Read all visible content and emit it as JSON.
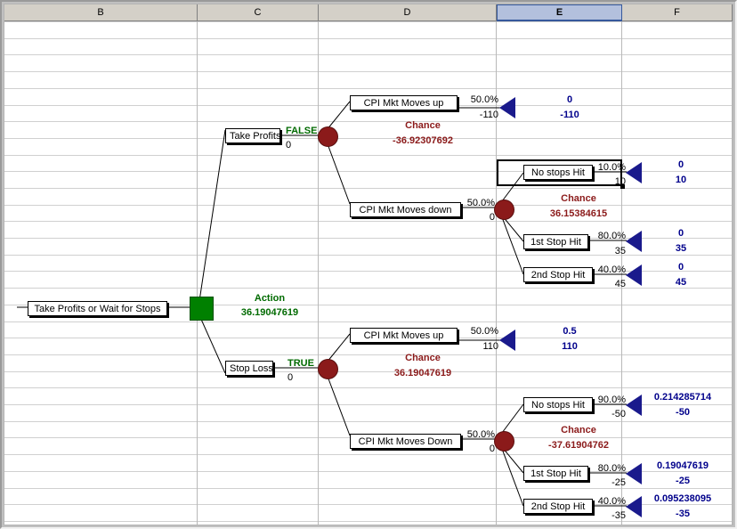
{
  "spreadsheet": {
    "columns": [
      {
        "label": "B",
        "selected": false
      },
      {
        "label": "C",
        "selected": false
      },
      {
        "label": "D",
        "selected": false
      },
      {
        "label": "E",
        "selected": true
      },
      {
        "label": "F",
        "selected": false
      }
    ]
  },
  "tree": {
    "root": {
      "label": "Take Profits or Wait for Stops",
      "node_type": "decision",
      "node_type_label": "Action",
      "value": "36.19047619",
      "value_color": "#006a00"
    },
    "branch_upper": {
      "label": "Take Profits",
      "flag": "FALSE",
      "payoff": "0",
      "node_type_label": "Chance",
      "value": "-36.92307692"
    },
    "branch_lower": {
      "label": "Stop Loss",
      "flag": "TRUE",
      "payoff": "0",
      "node_type_label": "Chance",
      "value": "36.19047619"
    },
    "upper_up": {
      "label": "CPI Mkt Moves up",
      "prob": "50.0%",
      "payoff": "-110",
      "endpoint_prob": "0",
      "endpoint_value": "-110"
    },
    "upper_down": {
      "label": "CPI Mkt Moves down",
      "prob": "50.0%",
      "payoff": "0",
      "node_type_label": "Chance",
      "value": "36.15384615",
      "children": [
        {
          "label": "No stops Hit",
          "prob": "10.0%",
          "payoff": "10",
          "endpoint_prob": "0",
          "endpoint_value": "10"
        },
        {
          "label": "1st Stop Hit",
          "prob": "80.0%",
          "payoff": "35",
          "endpoint_prob": "0",
          "endpoint_value": "35"
        },
        {
          "label": "2nd Stop Hit",
          "prob": "40.0%",
          "payoff": "45",
          "endpoint_prob": "0",
          "endpoint_value": "45"
        }
      ]
    },
    "lower_up": {
      "label": "CPI Mkt Moves up",
      "prob": "50.0%",
      "payoff": "110",
      "endpoint_prob": "0.5",
      "endpoint_value": "110"
    },
    "lower_down": {
      "label": "CPI Mkt Moves Down",
      "prob": "50.0%",
      "payoff": "0",
      "node_type_label": "Chance",
      "value": "-37.61904762",
      "children": [
        {
          "label": "No stops Hit",
          "prob": "90.0%",
          "payoff": "-50",
          "endpoint_prob": "0.214285714",
          "endpoint_value": "-50"
        },
        {
          "label": "1st Stop Hit",
          "prob": "80.0%",
          "payoff": "-25",
          "endpoint_prob": "0.19047619",
          "endpoint_value": "-25"
        },
        {
          "label": "2nd Stop Hit",
          "prob": "40.0%",
          "payoff": "-35",
          "endpoint_prob": "0.095238095",
          "endpoint_value": "-35"
        }
      ]
    }
  },
  "colors": {
    "chance_node": "#8b1a1a",
    "decision_node": "#008000",
    "endpoint": "#1a1a8c",
    "endpoint_text": "#00008b",
    "flag_text": "#006a00",
    "chance_text": "#8b1a1a",
    "header_selected": "#b3c0dd"
  }
}
